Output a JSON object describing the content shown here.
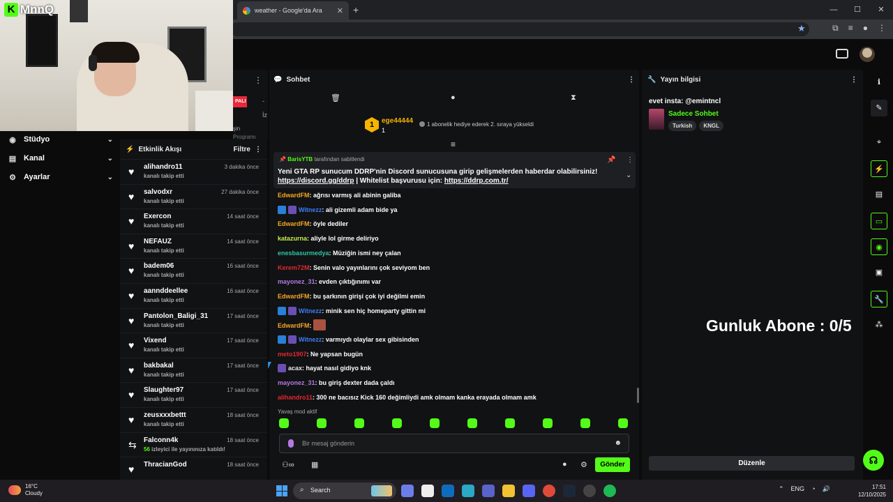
{
  "browser": {
    "tab_title": "weather - Google'da Ara",
    "new_tab": "+",
    "window_controls": [
      "—",
      "☐",
      "✕"
    ]
  },
  "webcam": {
    "logo_text": "MnnQ",
    "logo_letter": "K"
  },
  "partial_panel": {
    "badge": "PALI",
    "line1": "-",
    "line2": "İz",
    "line3": "şin",
    "line4": "Programı"
  },
  "left_nav": {
    "items": [
      {
        "label": "Stüdyo",
        "icon": "broadcast-icon"
      },
      {
        "label": "Kanal",
        "icon": "channel-icon"
      },
      {
        "label": "Ayarlar",
        "icon": "gear-icon"
      }
    ]
  },
  "activity": {
    "title": "Etkinlik Akışı",
    "filter": "Filtre",
    "rows": [
      {
        "name": "alihandro11",
        "sub": "kanalı takip etti",
        "time": "3 dakika önce"
      },
      {
        "name": "salvodxr",
        "sub": "kanalı takip etti",
        "time": "27 dakika önce"
      },
      {
        "name": "Exercon",
        "sub": "kanalı takip etti",
        "time": "14 saat önce"
      },
      {
        "name": "NEFAUZ",
        "sub": "kanalı takip etti",
        "time": "14 saat önce"
      },
      {
        "name": "badem06",
        "sub": "kanalı takip etti",
        "time": "16 saat önce"
      },
      {
        "name": "aannddeellee",
        "sub": "kanalı takip etti",
        "time": "16 saat önce"
      },
      {
        "name": "Pantolon_Baligi_31",
        "sub": "kanalı takip etti",
        "time": "17 saat önce"
      },
      {
        "name": "Vixend",
        "sub": "kanalı takip etti",
        "time": "17 saat önce"
      },
      {
        "name": "bakbakal",
        "sub": "kanalı takip etti",
        "time": "17 saat önce"
      },
      {
        "name": "Slaughter97",
        "sub": "kanalı takip etti",
        "time": "17 saat önce"
      },
      {
        "name": "zeusxxxbettt",
        "sub": "kanalı takip etti",
        "time": "18 saat önce"
      },
      {
        "name": "Falconn4k",
        "sub_num": "56",
        "sub": "izleyici ile yayınınıza katıldı!",
        "time": "18 saat önce",
        "raid": true
      },
      {
        "name": "ThracianGod",
        "sub": "",
        "time": "18 saat önce"
      }
    ]
  },
  "chat": {
    "title": "Sohbet",
    "gifter": {
      "level": "1",
      "name": "ege44444",
      "count": "1",
      "message": "1 abonelik hediye ederek 2. sıraya yükseldi"
    },
    "pinned": {
      "by_user": "BarisYTB",
      "by_suffix": "tarafından sabitlendi",
      "line1": "Yeni GTA RP sunucum DDRP'nin Discord sunucusuna girip gelişmelerden haberdar olabilirsiniz!",
      "link1": "https://discord.gg/ddrp",
      "mid": " | Whitelist başvurusu için: ",
      "link2": "https://ddrp.com.tr/"
    },
    "messages": [
      {
        "user": "EdwardFM",
        "color": "#f6a623",
        "text": "ağrısı varmış ali abinin galiba"
      },
      {
        "user": "Witnezz",
        "color": "#3e7ef7",
        "text": "ali gizemli adam bide ya",
        "badges": [
          "blue",
          "purple"
        ]
      },
      {
        "user": "EdwardFM",
        "color": "#f6a623",
        "text": "öyle dediler"
      },
      {
        "user": "katazurna",
        "color": "#c9ef4a",
        "text": "aliyle lol girme deliriyo"
      },
      {
        "user": "enesbasurmedya",
        "color": "#2ec5a5",
        "text": "Müziğin ismi ney çalan"
      },
      {
        "user": "Kerem72M",
        "color": "#e0282e",
        "text": "Senin valo yayınlarını çok seviyom ben"
      },
      {
        "user": "mayonez_31",
        "color": "#b37ae0",
        "text": "evden çıktığınımı var"
      },
      {
        "user": "EdwardFM",
        "color": "#f6a623",
        "text": "bu şarkının girişi çok iyi değilmi emin"
      },
      {
        "user": "Witnezz",
        "color": "#3e7ef7",
        "text": "minik sen hiç homeparty gittin mi",
        "badges": [
          "blue",
          "purple"
        ]
      },
      {
        "user": "EdwardFM",
        "color": "#f6a623",
        "text": "",
        "emote": true
      },
      {
        "user": "Witnezz",
        "color": "#3e7ef7",
        "text": "varmıydı olaylar sex gibisinden",
        "badges": [
          "blue",
          "purple"
        ]
      },
      {
        "user": "meto1907",
        "color": "#e0282e",
        "text": "Ne yapsan bugün"
      },
      {
        "user": "acax",
        "color": "#e8e8e8",
        "text": "hayat nasıl gidiyo knk",
        "badges": [
          "purple"
        ]
      },
      {
        "user": "mayonez_31",
        "color": "#b37ae0",
        "text": "bu giriş dexter dada çaldı"
      },
      {
        "user": "alihandro11",
        "color": "#e0282e",
        "text": "300 ne bacısız Kick 160 değimliydi amk olmam kanka erayada olmam amk"
      }
    ],
    "slow_mode": "Yavaş mod aktif",
    "input_placeholder": "Bir mesaj gönderin",
    "send_label": "Gönder"
  },
  "stream_info": {
    "title": "Yayın bilgisi",
    "stream_title": "evet insta: @emintncl",
    "category": "Sadece Sohbet",
    "tags": [
      "Turkish",
      "KNGL"
    ],
    "overlay": "Gunluk Abone : 0/5",
    "edit_label": "Düzenle"
  },
  "taskbar": {
    "temp": "16°C",
    "condition": "Cloudy",
    "search_label": "Search",
    "lang": "ENG",
    "time": "17:51",
    "date": "12/10/2025"
  }
}
